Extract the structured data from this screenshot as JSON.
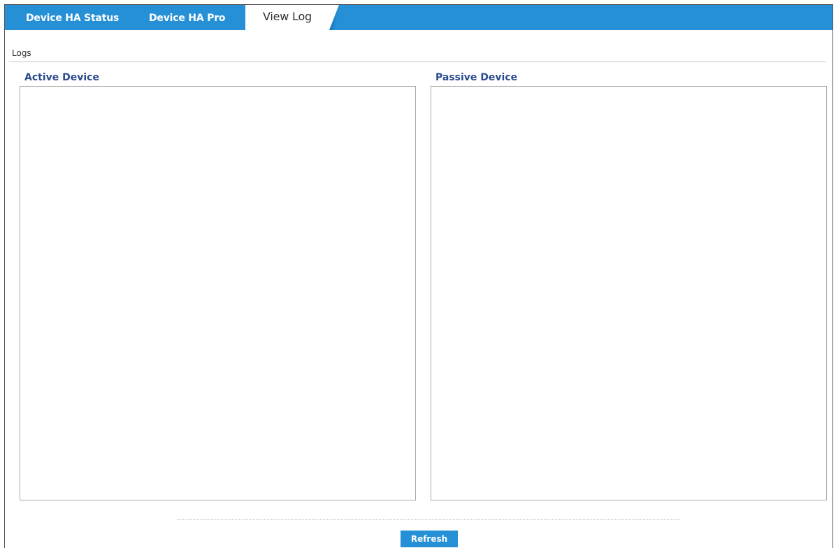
{
  "tabs": [
    {
      "label": "Device HA Status",
      "active": false
    },
    {
      "label": "Device HA Pro",
      "active": false
    },
    {
      "label": "View Log",
      "active": true
    }
  ],
  "section": {
    "title": "Logs"
  },
  "panels": {
    "active": {
      "heading": "Active Device",
      "content": ""
    },
    "passive": {
      "heading": "Passive Device",
      "content": ""
    }
  },
  "actions": {
    "refresh_label": "Refresh"
  },
  "colors": {
    "accent": "#2590d6",
    "heading": "#2a4b8c",
    "border": "#a8a8a8"
  }
}
